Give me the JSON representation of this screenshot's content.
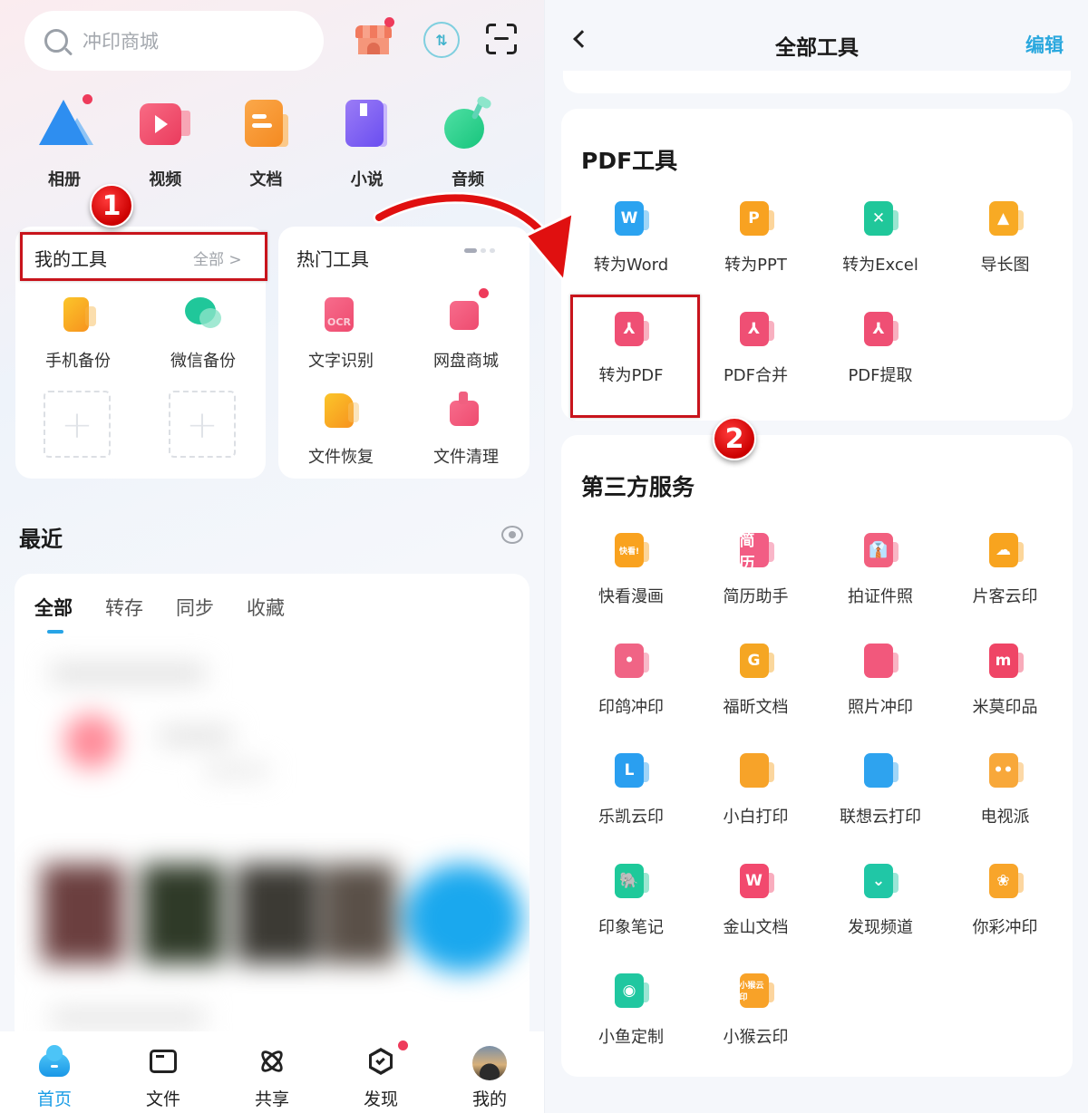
{
  "left": {
    "search": {
      "placeholder": "冲印商城"
    },
    "header_icons": [
      "store-icon",
      "sync-transfer-icon",
      "scan-icon"
    ],
    "quick_entries": [
      {
        "label": "相册",
        "icon": "album-icon",
        "has_dot": true
      },
      {
        "label": "视频",
        "icon": "video-icon"
      },
      {
        "label": "文档",
        "icon": "document-icon"
      },
      {
        "label": "小说",
        "icon": "novel-icon"
      },
      {
        "label": "音频",
        "icon": "audio-icon"
      }
    ],
    "my_tools": {
      "title": "我的工具",
      "more_label": "全部 >",
      "items": [
        {
          "label": "手机备份",
          "icon": "phone-backup-icon"
        },
        {
          "label": "微信备份",
          "icon": "wechat-backup-icon"
        }
      ],
      "add_slot_symbol": "+"
    },
    "hot_tools": {
      "title": "热门工具",
      "items": [
        {
          "label": "文字识别",
          "icon": "ocr-icon"
        },
        {
          "label": "网盘商城",
          "icon": "store-icon",
          "has_dot": true
        },
        {
          "label": "文件恢复",
          "icon": "file-recovery-icon"
        },
        {
          "label": "文件清理",
          "icon": "file-cleanup-icon"
        }
      ],
      "page_indicator": {
        "current": 1,
        "total": 3
      }
    },
    "recent": {
      "title": "最近",
      "tabs": [
        {
          "label": "全部",
          "active": true
        },
        {
          "label": "转存"
        },
        {
          "label": "同步"
        },
        {
          "label": "收藏"
        }
      ]
    },
    "bottom_nav": [
      {
        "label": "首页",
        "icon": "home-cloud-icon",
        "active": true
      },
      {
        "label": "文件",
        "icon": "folder-icon"
      },
      {
        "label": "共享",
        "icon": "share-orbit-icon"
      },
      {
        "label": "发现",
        "icon": "discover-icon",
        "has_dot": true
      },
      {
        "label": "我的",
        "icon": "avatar"
      }
    ]
  },
  "right": {
    "header": {
      "title": "全部工具",
      "edit_label": "编辑"
    },
    "pdf_tools": {
      "title": "PDF工具",
      "items": [
        {
          "label": "转为Word",
          "glyph": "W",
          "color": "#2ba3f0"
        },
        {
          "label": "转为PPT",
          "glyph": "P",
          "color": "#f8a221"
        },
        {
          "label": "转为Excel",
          "glyph": "✕",
          "color": "#20c79a"
        },
        {
          "label": "导长图",
          "glyph": "▲",
          "color": "#f8aa24"
        },
        {
          "label": "转为PDF",
          "glyph": "⅄",
          "color": "#ef4f74"
        },
        {
          "label": "PDF合并",
          "glyph": "⅄",
          "color": "#ef4f74"
        },
        {
          "label": "PDF提取",
          "glyph": "⅄",
          "color": "#ef4f74"
        }
      ]
    },
    "third_party": {
      "title": "第三方服务",
      "items": [
        {
          "label": "快看漫画",
          "glyph": "快看!",
          "color": "#f9a21f"
        },
        {
          "label": "简历助手",
          "glyph": "简历",
          "color": "#f25d84"
        },
        {
          "label": "拍证件照",
          "glyph": "👔",
          "color": "#f2607f"
        },
        {
          "label": "片客云印",
          "glyph": "☁",
          "color": "#f8a41f"
        },
        {
          "label": "印鸽冲印",
          "glyph": "•",
          "color": "#f06485"
        },
        {
          "label": "福昕文档",
          "glyph": "G",
          "color": "#f5a623"
        },
        {
          "label": "照片冲印",
          "glyph": "",
          "color": "#f2587c"
        },
        {
          "label": "米莫印品",
          "glyph": "m",
          "color": "#ef4566"
        },
        {
          "label": "乐凯云印",
          "glyph": "L",
          "color": "#2a9ff0"
        },
        {
          "label": "小白打印",
          "glyph": "",
          "color": "#f7a329"
        },
        {
          "label": "联想云打印",
          "glyph": "",
          "color": "#2ea3ef"
        },
        {
          "label": "电视派",
          "glyph": "••",
          "color": "#f8a83a"
        },
        {
          "label": "印象笔记",
          "glyph": "🐘",
          "color": "#1ec99a"
        },
        {
          "label": "金山文档",
          "glyph": "W",
          "color": "#f2496e"
        },
        {
          "label": "发现频道",
          "glyph": "⌄",
          "color": "#20c7a6"
        },
        {
          "label": "你彩冲印",
          "glyph": "❀",
          "color": "#f8a52a"
        },
        {
          "label": "小鱼定制",
          "glyph": "◉",
          "color": "#20c7a0"
        },
        {
          "label": "小猴云印",
          "glyph": "小猴云印",
          "color": "#f8a228"
        }
      ]
    }
  },
  "annotations": [
    {
      "number": "1",
      "target": "我的工具"
    },
    {
      "number": "2",
      "target": "转为PDF"
    }
  ]
}
